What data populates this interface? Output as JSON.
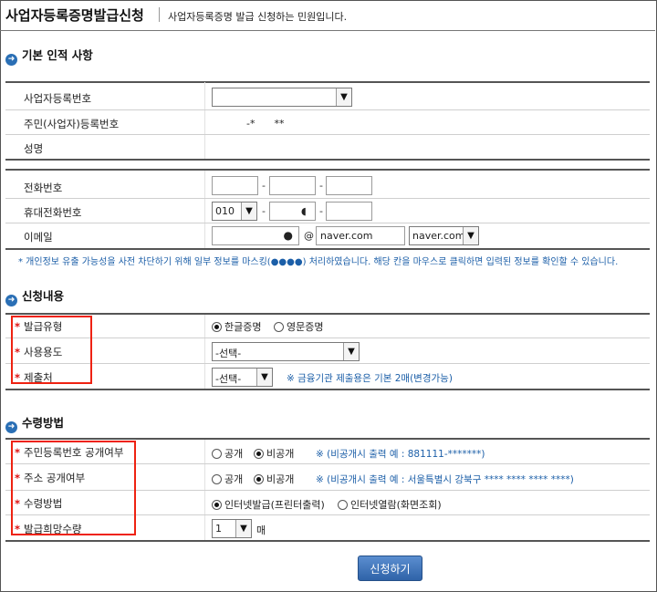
{
  "header": {
    "title": "사업자등록증명발급신청",
    "subtitle": "사업자등록증명 발급 신청하는 민원입니다."
  },
  "basic": {
    "section_title": "기본 인적 사항",
    "biz_no_label": "사업자등록번호",
    "resident_label": "주민(사업자)등록번호",
    "resident_value": "-*      **",
    "name_label": "성명",
    "phone_label": "전화번호",
    "mobile_label": "휴대전화번호",
    "mobile_prefix": "010",
    "email_label": "이메일",
    "email_at": "@",
    "email_domain_value": "naver.com",
    "email_domain_select": "naver.com",
    "privacy_note": "* 개인정보 유출 가능성을 사전 차단하기 위해 일부 정보를 마스킹(●●●●) 처리하였습니다. 해당 칸을 마우스로 클릭하면 입력된 정보를 확인할 수 있습니다."
  },
  "apply": {
    "section_title": "신청내용",
    "issue_type_label": "발급유형",
    "issue_type_options": [
      "한글증명",
      "영문증명"
    ],
    "usage_label": "사용용도",
    "usage_value": "-선택-",
    "submit_to_label": "제출처",
    "submit_to_value": "-선택-",
    "submit_to_note": "※ 금융기관 제출용은 기본 2매(변경가능)"
  },
  "receive": {
    "section_title": "수령방법",
    "resident_disclose_label": "주민등록번호 공개여부",
    "address_disclose_label": "주소 공개여부",
    "disclose_options": [
      "공개",
      "비공개"
    ],
    "resident_disclose_note": "※ (비공개시 출력 예 : 881111-*******)",
    "address_disclose_note": "※ (비공개시 출력 예 : 서울특별시 강북구 **** **** **** ****)",
    "method_label": "수령방법",
    "method_options": [
      "인터넷발급(프린터출력)",
      "인터넷열람(화면조회)"
    ],
    "quantity_label": "발급희망수량",
    "quantity_value": "1",
    "quantity_unit": "매"
  },
  "submit_label": "신청하기",
  "colors": {
    "accent": "#2a6fb5",
    "required": "#dd1111",
    "note": "#1c5fa8"
  }
}
